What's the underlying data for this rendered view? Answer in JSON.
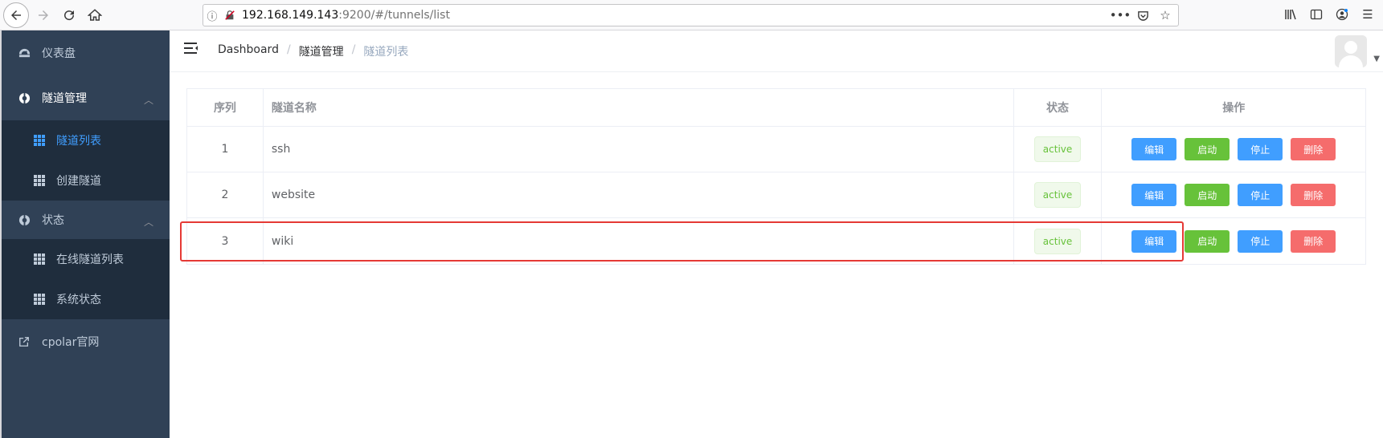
{
  "browser": {
    "url_host": "192.168.149.143",
    "url_rest": ":9200/#/tunnels/list"
  },
  "sidebar": {
    "dashboard": "仪表盘",
    "tunnel_mgmt": "隧道管理",
    "tunnel_list": "隧道列表",
    "create_tunnel": "创建隧道",
    "status": "状态",
    "online_tunnels": "在线隧道列表",
    "system_status": "系统状态",
    "website": "cpolar官网"
  },
  "breadcrumb": {
    "home": "Dashboard",
    "section": "隧道管理",
    "current": "隧道列表",
    "separator": "/"
  },
  "table": {
    "headers": [
      "序列",
      "隧道名称",
      "状态",
      "操作"
    ],
    "rows": [
      {
        "index": "1",
        "name": "ssh",
        "status": "active"
      },
      {
        "index": "2",
        "name": "website",
        "status": "active"
      },
      {
        "index": "3",
        "name": "wiki",
        "status": "active"
      }
    ],
    "actions": {
      "edit": "编辑",
      "start": "启动",
      "stop": "停止",
      "delete": "删除"
    }
  },
  "colors": {
    "sidebar_bg": "#304156",
    "submenu_bg": "#1f2d3d",
    "accent": "#409eff",
    "success": "#67c23a",
    "danger": "#f56c6c",
    "highlight": "#e53935"
  }
}
